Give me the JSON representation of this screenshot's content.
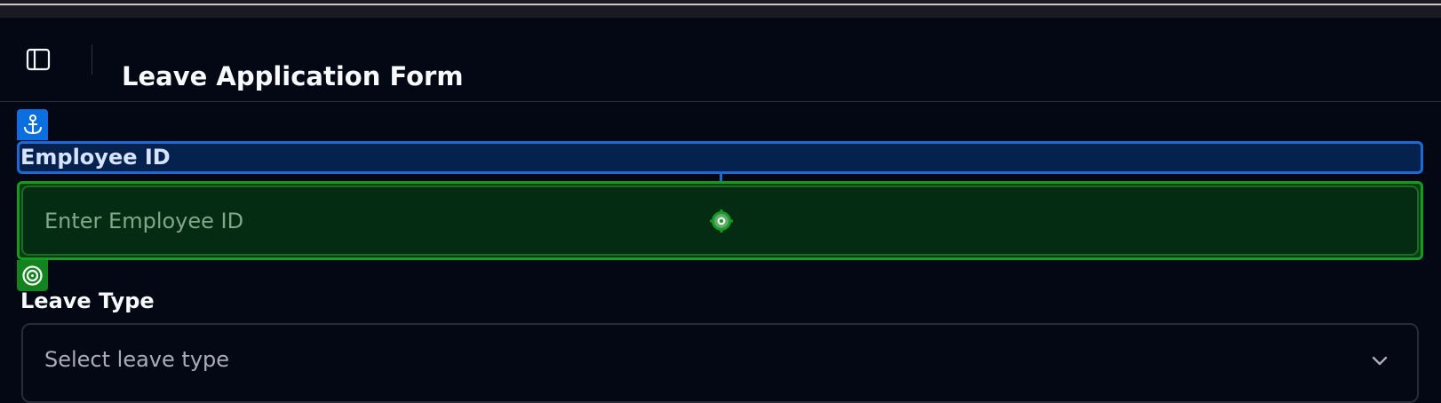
{
  "header": {
    "title": "Leave Application Form",
    "sidebar_toggle_icon": "sidebar-panel-icon"
  },
  "form": {
    "employee_id": {
      "label": "Employee ID",
      "placeholder": "Enter Employee ID",
      "value": ""
    },
    "leave_type": {
      "label": "Leave Type",
      "selected": "Select leave type",
      "icon": "chevron-down-icon"
    }
  },
  "overlay": {
    "anchor_icon": "anchor-icon",
    "target_icon": "target-icon",
    "crosshair_icon": "crosshair-icon",
    "label_highlight_color": "#1d6ad4",
    "input_highlight_color": "#159a22"
  },
  "colors": {
    "background": "#040814",
    "border": "#262d39",
    "text": "#f8fafc",
    "placeholder": "#a7adb8"
  }
}
